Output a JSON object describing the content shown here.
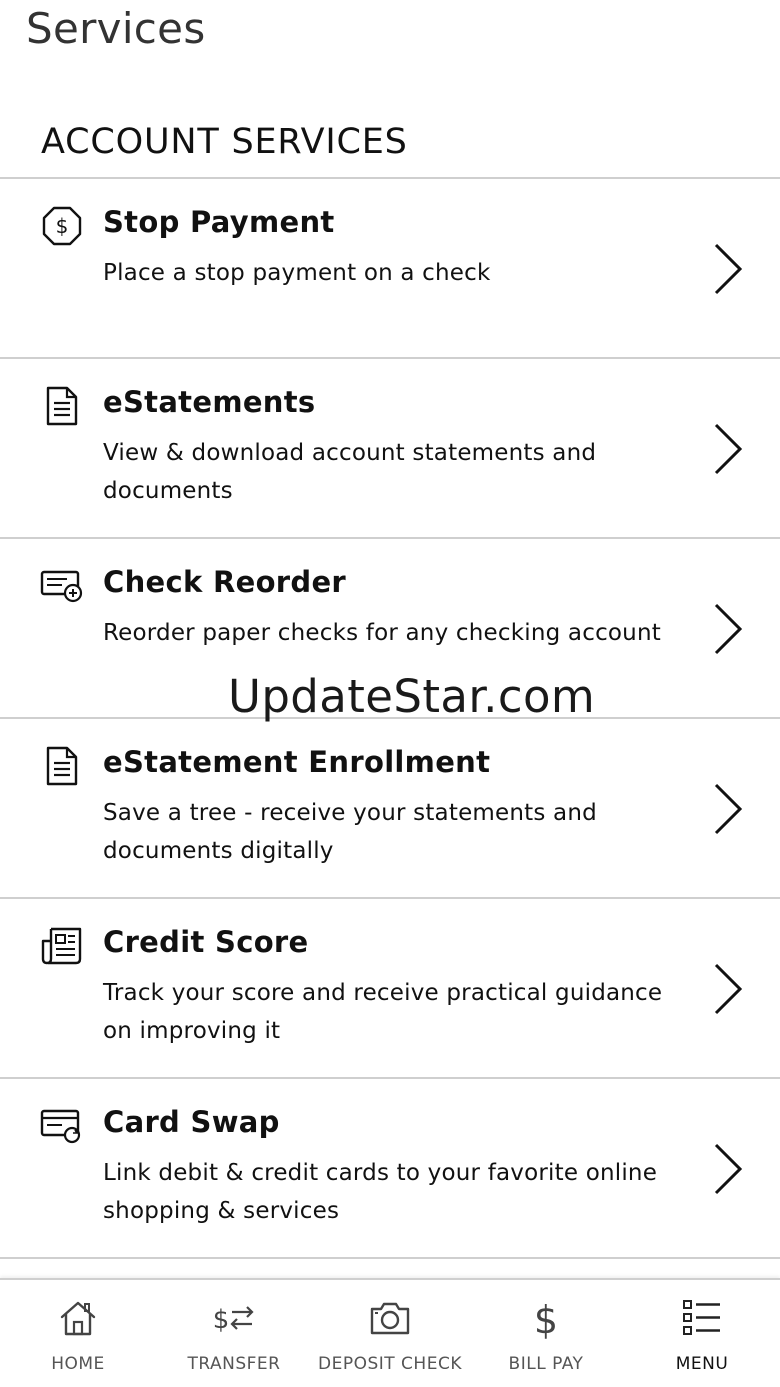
{
  "header": {
    "title": "Services",
    "section_heading": "ACCOUNT SERVICES"
  },
  "services": [
    {
      "icon": "dollar-badge-icon",
      "title": "Stop Payment",
      "description": "Place a stop payment on a check"
    },
    {
      "icon": "document-icon",
      "title": "eStatements",
      "description": "View & download account statements and documents"
    },
    {
      "icon": "check-plus-icon",
      "title": "Check Reorder",
      "description": "Reorder paper checks for any checking account"
    },
    {
      "icon": "document-icon",
      "title": "eStatement Enrollment",
      "description": "Save a tree - receive your statements and documents digitally"
    },
    {
      "icon": "newspaper-icon",
      "title": "Credit Score",
      "description": "Track your score and receive practical guidance on improving it"
    },
    {
      "icon": "card-swap-icon",
      "title": "Card Swap",
      "description": "Link debit & credit cards to your favorite online shopping & services"
    }
  ],
  "watermark": "UpdateStar.com",
  "bottom_nav": {
    "items": [
      {
        "label": "HOME",
        "icon": "home-icon"
      },
      {
        "label": "TRANSFER",
        "icon": "transfer-icon"
      },
      {
        "label": "DEPOSIT CHECK",
        "icon": "camera-icon"
      },
      {
        "label": "BILL PAY",
        "icon": "dollar-icon"
      },
      {
        "label": "MENU",
        "icon": "menu-list-icon"
      }
    ],
    "active": "MENU"
  },
  "colors": {
    "text": "#111111",
    "divider": "#cfcfcf",
    "nav_label": "#555555"
  }
}
